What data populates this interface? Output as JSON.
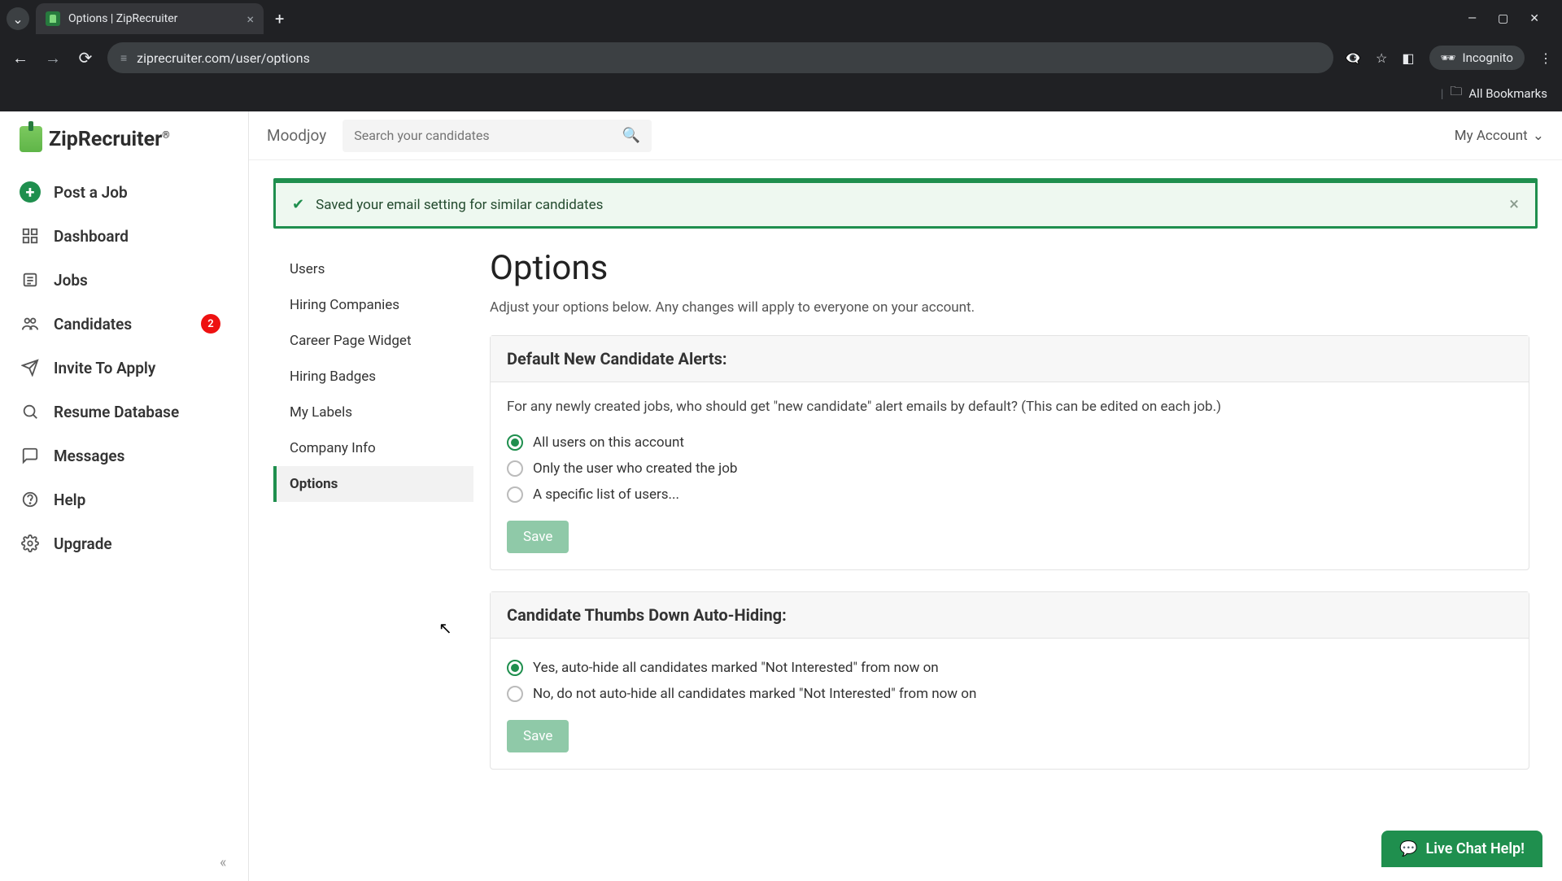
{
  "browser": {
    "tab_title": "Options | ZipRecruiter",
    "url": "ziprecruiter.com/user/options",
    "incognito_label": "Incognito",
    "bookmarks_label": "All Bookmarks"
  },
  "sidebar": {
    "logo_text": "ZipRecruiter",
    "items": [
      {
        "label": "Post a Job"
      },
      {
        "label": "Dashboard"
      },
      {
        "label": "Jobs"
      },
      {
        "label": "Candidates",
        "badge": "2"
      },
      {
        "label": "Invite To Apply"
      },
      {
        "label": "Resume Database"
      },
      {
        "label": "Messages"
      },
      {
        "label": "Help"
      },
      {
        "label": "Upgrade"
      }
    ]
  },
  "topbar": {
    "company": "Moodjoy",
    "search_placeholder": "Search your candidates",
    "account_label": "My Account"
  },
  "banner": {
    "text": "Saved your email setting for similar candidates"
  },
  "subnav": {
    "items": [
      {
        "label": "Users"
      },
      {
        "label": "Hiring Companies"
      },
      {
        "label": "Career Page Widget"
      },
      {
        "label": "Hiring Badges"
      },
      {
        "label": "My Labels"
      },
      {
        "label": "Company Info"
      },
      {
        "label": "Options",
        "active": true
      }
    ]
  },
  "page": {
    "title": "Options",
    "subtitle": "Adjust your options below. Any changes will apply to everyone on your account."
  },
  "card1": {
    "title": "Default New Candidate Alerts:",
    "desc": "For any newly created jobs, who should get \"new candidate\" alert emails by default? (This can be edited on each job.)",
    "opt1": "All users on this account",
    "opt2": "Only the user who created the job",
    "opt3": "A specific list of users...",
    "save": "Save"
  },
  "card2": {
    "title": "Candidate Thumbs Down Auto-Hiding:",
    "opt1": "Yes, auto-hide all candidates marked \"Not Interested\" from now on",
    "opt2": "No, do not auto-hide all candidates marked \"Not Interested\" from now on",
    "save": "Save"
  },
  "chat": {
    "label": "Live Chat Help!"
  }
}
